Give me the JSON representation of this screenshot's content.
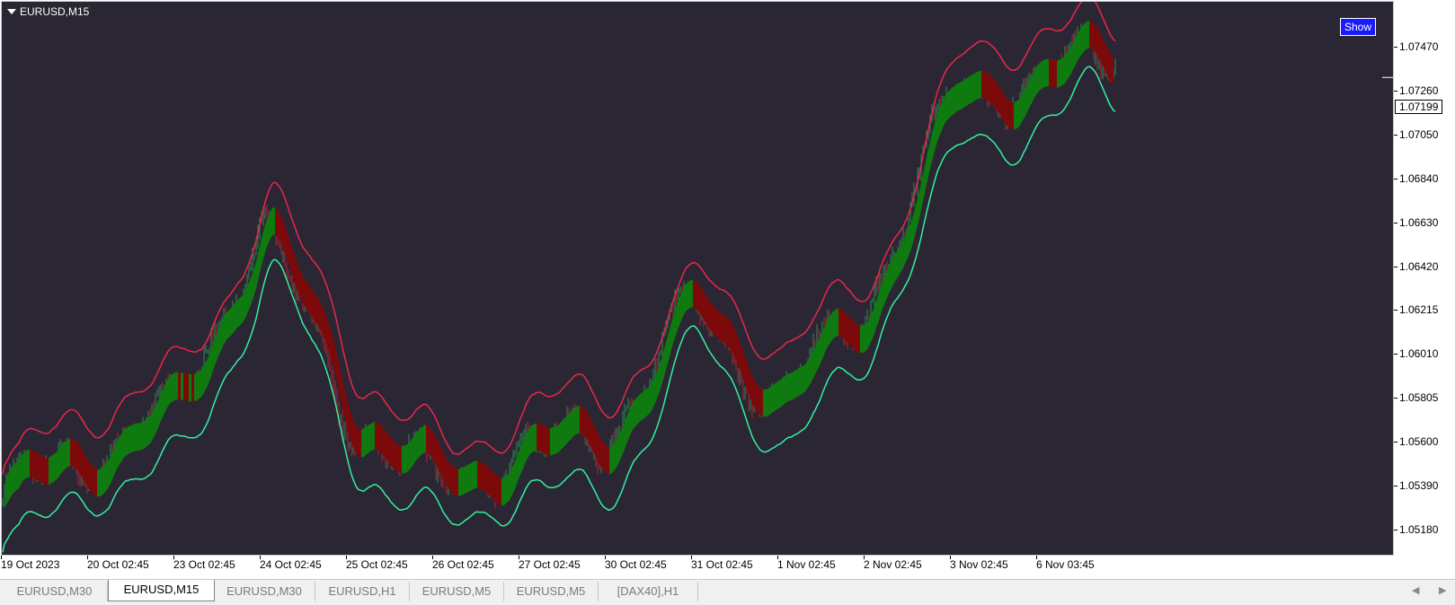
{
  "window": {
    "symbol": "EURUSD,M15",
    "show_button": "Show",
    "current_price": "1.07199"
  },
  "price_axis": [
    "1.07470",
    "1.07260",
    "1.07050",
    "1.06840",
    "1.06630",
    "1.06420",
    "1.06215",
    "1.06010",
    "1.05805",
    "1.05600",
    "1.05390",
    "1.05180"
  ],
  "time_axis": [
    "19 Oct 2023",
    "20 Oct 02:45",
    "23 Oct 02:45",
    "24 Oct 02:45",
    "25 Oct 02:45",
    "26 Oct 02:45",
    "27 Oct 02:45",
    "30 Oct 02:45",
    "31 Oct 02:45",
    "1 Nov 02:45",
    "2 Nov 02:45",
    "3 Nov 02:45",
    "6 Nov 03:45"
  ],
  "tabs": [
    {
      "label": "EURUSD,M30",
      "active": false
    },
    {
      "label": "EURUSD,M15",
      "active": true
    },
    {
      "label": "EURUSD,M30",
      "active": false
    },
    {
      "label": "EURUSD,H1",
      "active": false
    },
    {
      "label": "EURUSD,M5",
      "active": false
    },
    {
      "label": "EURUSD,M5",
      "active": false
    },
    {
      "label": "[DAX40],H1",
      "active": false
    }
  ],
  "colors": {
    "background": "#2b2633",
    "bull_band": "#0f7a0f",
    "bear_band": "#7d0a0a",
    "upper_line": "#e8284a",
    "lower_line": "#33f0a0",
    "candle_up": "#2e8b57",
    "candle_down": "#b22234"
  },
  "chart_data": {
    "type": "line",
    "symbol": "EURUSD",
    "timeframe": "M15",
    "ylim": [
      1.0511,
      1.0753
    ],
    "x": [
      "19 Oct 2023",
      "20 Oct 02:45",
      "23 Oct 02:45",
      "24 Oct 02:45",
      "25 Oct 02:45",
      "26 Oct 02:45",
      "27 Oct 02:45",
      "30 Oct 02:45",
      "31 Oct 02:45",
      "1 Nov 02:45",
      "2 Nov 02:45",
      "3 Nov 02:45",
      "6 Nov 03:45"
    ],
    "series": [
      {
        "values": [
          1.0536,
          1.0555,
          1.0573,
          1.0655,
          1.0573,
          1.0542,
          1.0555,
          1.0563,
          1.062,
          1.0578,
          1.0619,
          1.071,
          1.072
        ]
      }
    ]
  }
}
